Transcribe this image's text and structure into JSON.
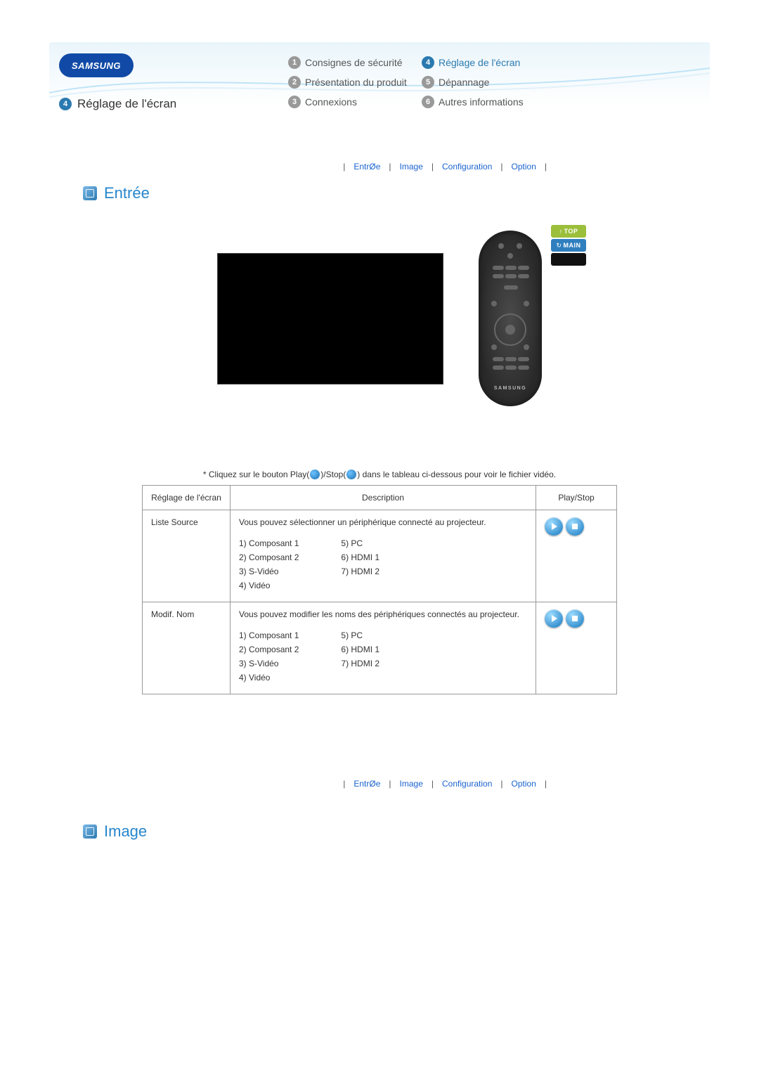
{
  "header": {
    "logo_text": "SAMSUNG",
    "page_number": "4",
    "page_title": "Réglage de l'écran",
    "nav": [
      {
        "num": "1",
        "label": "Consignes de sécurité",
        "active": false
      },
      {
        "num": "2",
        "label": "Présentation du produit",
        "active": false
      },
      {
        "num": "3",
        "label": "Connexions",
        "active": false
      },
      {
        "num": "4",
        "label": "Réglage de l'écran",
        "active": true
      },
      {
        "num": "5",
        "label": "Dépannage",
        "active": false
      },
      {
        "num": "6",
        "label": "Autres informations",
        "active": false
      }
    ]
  },
  "tabs": {
    "items": [
      "EntrØe",
      "Image",
      "Configuration",
      "Option"
    ]
  },
  "sections": {
    "entree_title": "Entrée",
    "image_title": "Image"
  },
  "side_buttons": {
    "top": "TOP",
    "main": "MAIN"
  },
  "remote": {
    "brand": "SAMSUNG"
  },
  "note": {
    "prefix": "* Cliquez sur le bouton Play(",
    "mid": ")/Stop(",
    "suffix": ") dans le tableau ci-dessous pour voir le fichier vidéo."
  },
  "table": {
    "headers": {
      "col1": "Réglage de l'écran",
      "col2": "Description",
      "col3": "Play/Stop"
    },
    "rows": [
      {
        "name": "Liste Source",
        "desc": "Vous pouvez sélectionner un périphérique connecté au projecteur.",
        "list_left": [
          "1) Composant 1",
          "2) Composant 2",
          "3) S-Vidéo",
          "4) Vidéo"
        ],
        "list_right": [
          "5) PC",
          "6) HDMI 1",
          "7) HDMI 2"
        ]
      },
      {
        "name": "Modif. Nom",
        "desc": "Vous pouvez modifier les noms des périphériques connectés au projecteur.",
        "list_left": [
          "1) Composant 1",
          "2) Composant 2",
          "3) S-Vidéo",
          "4) Vidéo"
        ],
        "list_right": [
          "5) PC",
          "6) HDMI 1",
          "7) HDMI 2"
        ]
      }
    ]
  }
}
